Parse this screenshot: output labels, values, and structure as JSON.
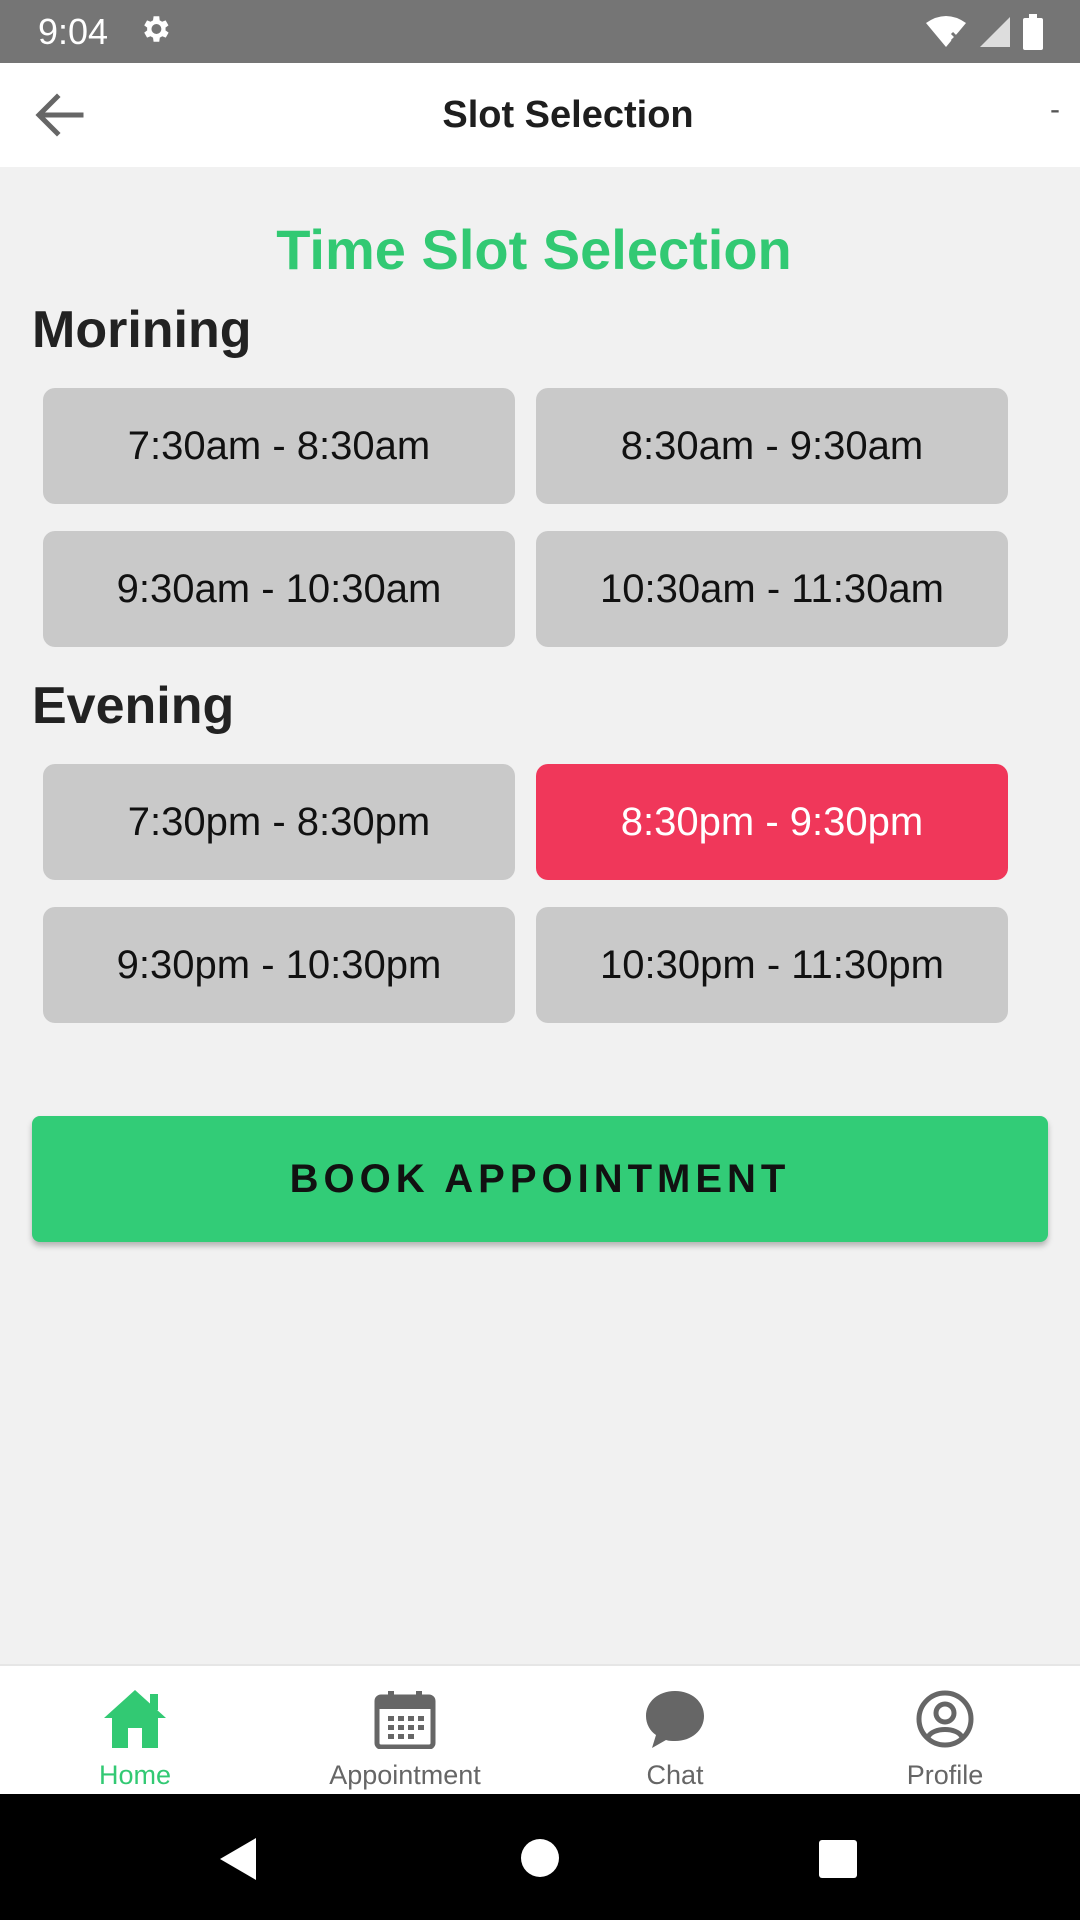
{
  "status_bar": {
    "time": "9:04",
    "icons": [
      "gear-icon",
      "wifi-icon",
      "signal-icon",
      "battery-icon"
    ]
  },
  "app_bar": {
    "title": "Slot Selection",
    "back_icon": "arrow-left-icon",
    "trailing_text": "-"
  },
  "main": {
    "heading": "Time Slot Selection",
    "morning": {
      "title": "Morining",
      "slots": [
        "7:30am - 8:30am",
        "8:30am - 9:30am",
        "9:30am - 10:30am",
        "10:30am - 11:30am"
      ]
    },
    "evening": {
      "title": "Evening",
      "slots": [
        "7:30pm - 8:30pm",
        "8:30pm - 9:30pm",
        "9:30pm - 10:30pm",
        "10:30pm - 11:30pm"
      ]
    },
    "selected_slot": "8:30pm - 9:30pm",
    "book_button": "BOOK APPOINTMENT"
  },
  "bottom_nav": {
    "items": [
      {
        "label": "Home",
        "icon": "home-icon",
        "active": true
      },
      {
        "label": "Appointment",
        "icon": "calendar-icon",
        "active": false
      },
      {
        "label": "Chat",
        "icon": "chat-bubble-icon",
        "active": false
      },
      {
        "label": "Profile",
        "icon": "profile-icon",
        "active": false
      }
    ]
  },
  "colors": {
    "accent_green": "#32c973",
    "selected_red": "#f0375a",
    "slot_gray": "#c9c9c9",
    "status_bar": "#757575"
  }
}
